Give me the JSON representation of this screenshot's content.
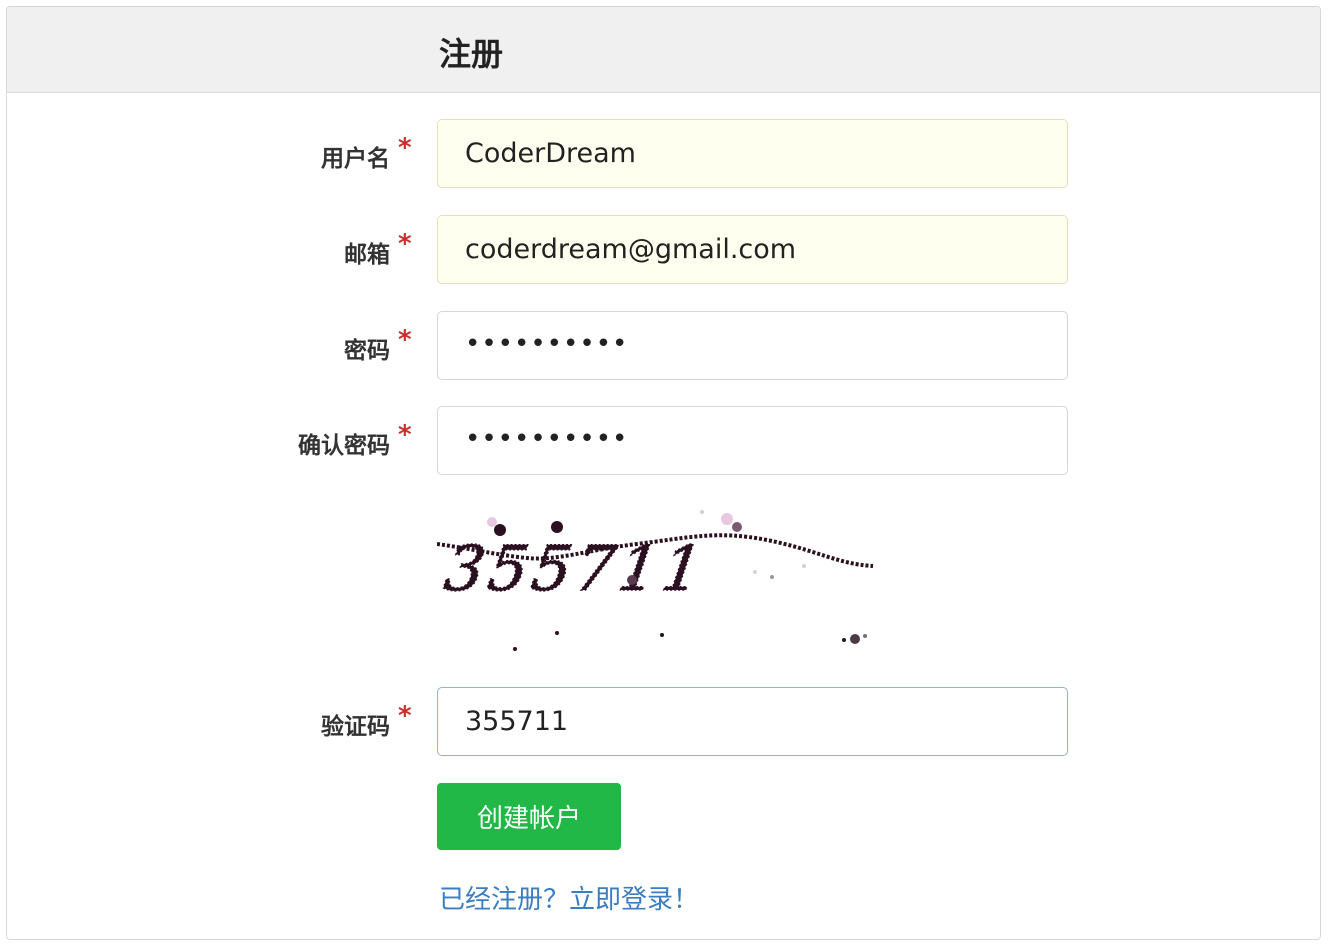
{
  "header": {
    "title": "注册"
  },
  "form": {
    "required_mark": "*",
    "username": {
      "label": "用户名",
      "value": "CoderDream"
    },
    "email": {
      "label": "邮箱",
      "value": "coderdream@gmail.com"
    },
    "password": {
      "label": "密码",
      "value": "••••••••••"
    },
    "confirm_password": {
      "label": "确认密码",
      "value": "••••••••••"
    },
    "captcha": {
      "label": "验证码",
      "image_text": "355711",
      "value": "355711"
    },
    "submit_label": "创建帐户",
    "login_link": "已经注册？立即登录！"
  },
  "colors": {
    "submit": "#22b848",
    "link": "#3a7dc0",
    "required": "#c9302c",
    "autofill_bg": "#fffff0"
  }
}
